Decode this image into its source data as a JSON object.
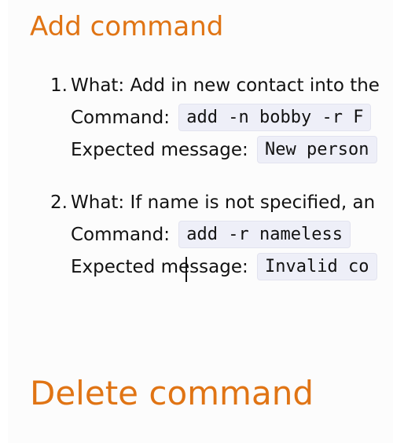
{
  "sections": {
    "add": {
      "title": "Add command",
      "items": [
        {
          "number": "1.",
          "what": "What: Add in new contact into the",
          "command_label": "Command:",
          "command": "add -n bobby -r F",
          "expected_label": "Expected message:",
          "expected": "New person"
        },
        {
          "number": "2.",
          "what": "What: If name is not specified, an",
          "command_label": "Command:",
          "command": "add -r nameless",
          "expected_label": "Expected message:",
          "expected": "Invalid co"
        }
      ]
    },
    "delete": {
      "title": "Delete command"
    }
  },
  "colors": {
    "heading": "#e07414",
    "code_background": "#eeeff8",
    "page_background": "#fcfcfc"
  }
}
